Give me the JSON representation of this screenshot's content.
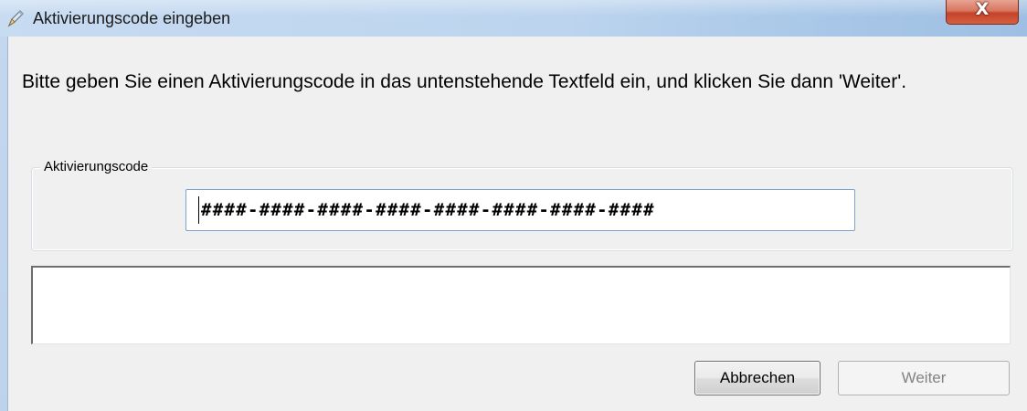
{
  "window": {
    "title": "Aktivierungscode eingeben",
    "close_symbol": "X",
    "app_icon": "pen-icon"
  },
  "dialog": {
    "instruction": "Bitte geben Sie einen Aktivierungscode in das untenstehende Textfeld ein, und klicken Sie dann 'Weiter'.",
    "group_label": "Aktivierungscode",
    "code_mask": "####-####-####-####-####-####-####-####",
    "message": ""
  },
  "buttons": {
    "cancel_label": "Abbrechen",
    "next_label": "Weiter",
    "next_enabled": false
  }
}
